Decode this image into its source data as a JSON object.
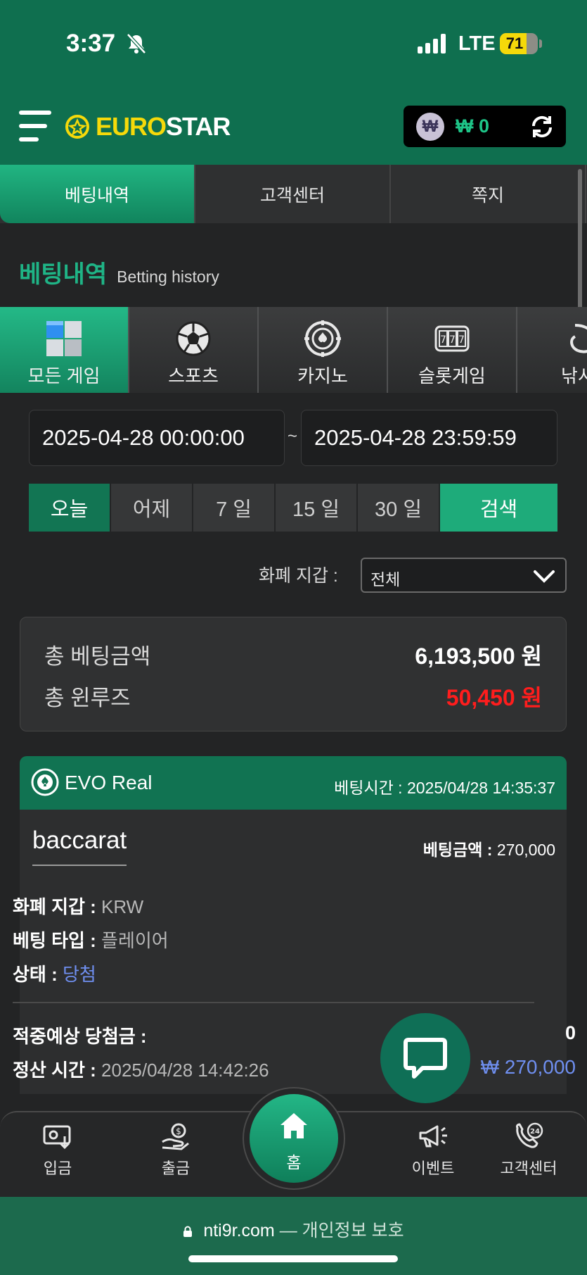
{
  "status_bar": {
    "time": "3:37",
    "network": "LTE",
    "battery": "71",
    "battery_level": 0.71
  },
  "header": {
    "logo_part1": "EURO",
    "logo_part2": "STAR",
    "wallet_symbol": "₩",
    "wallet_amount": "₩ 0"
  },
  "top_tabs": [
    {
      "label": "베팅내역",
      "active": true
    },
    {
      "label": "고객센터",
      "active": false
    },
    {
      "label": "쪽지",
      "active": false
    }
  ],
  "section": {
    "title_ko": "베팅내역",
    "title_en": "Betting history"
  },
  "categories": [
    {
      "label": "모든 게임",
      "icon": "cubes-icon",
      "active": true
    },
    {
      "label": "스포츠",
      "icon": "soccer-ball-icon"
    },
    {
      "label": "카지노",
      "icon": "casino-chip-icon"
    },
    {
      "label": "슬롯게임",
      "icon": "slot-machine-icon"
    },
    {
      "label": "낚시",
      "icon": "fish-icon"
    }
  ],
  "filters": {
    "date_from": "2025-04-28 00:00:00",
    "date_to": "2025-04-28 23:59:59",
    "tilde": "~",
    "periods": [
      "오늘",
      "어제",
      "7 일",
      "15 일",
      "30 일"
    ],
    "search_label": "검색",
    "currency_label": "화폐 지갑 :",
    "currency_value": "전체"
  },
  "summary": {
    "total_bet_label": "총 베팅금액",
    "total_bet_value": "6,193,500 원",
    "total_winloss_label": "총 윈루즈",
    "total_winloss_value": "50,450 원"
  },
  "bet": {
    "provider": "EVO Real",
    "bet_time": "베팅시간 : 2025/04/28 14:35:37",
    "game": "baccarat",
    "bet_amount_label": "베팅금액 :",
    "bet_amount": "270,000",
    "currency_label": "화폐 지갑 :",
    "currency": "KRW",
    "type_label": "베팅 타입 :",
    "type": "플레이어",
    "status_label": "상태 :",
    "status": "당첨",
    "expected_label": "적중예상 당첨금 :",
    "expected_value": "0",
    "settle_label": "정산 시간 :",
    "settle_time": "2025/04/28 14:42:26",
    "settle_amount": "₩ 270,000"
  },
  "bottom_nav": [
    {
      "label": "입금",
      "icon": "deposit-icon"
    },
    {
      "label": "출금",
      "icon": "withdraw-icon"
    },
    {
      "label": "홈",
      "icon": "home-icon"
    },
    {
      "label": "이벤트",
      "icon": "megaphone-icon"
    },
    {
      "label": "고객센터",
      "icon": "support-24-icon"
    }
  ],
  "url_bar": {
    "domain": "nti9r.com",
    "suffix": "— 개인정보 보호"
  },
  "colors": {
    "brand_green": "#0f6f4f",
    "accent_green": "#1eab7a",
    "loss_red": "#ff1d1d",
    "win_blue": "#6f8ff0",
    "logo_yellow": "#f5d90a"
  }
}
